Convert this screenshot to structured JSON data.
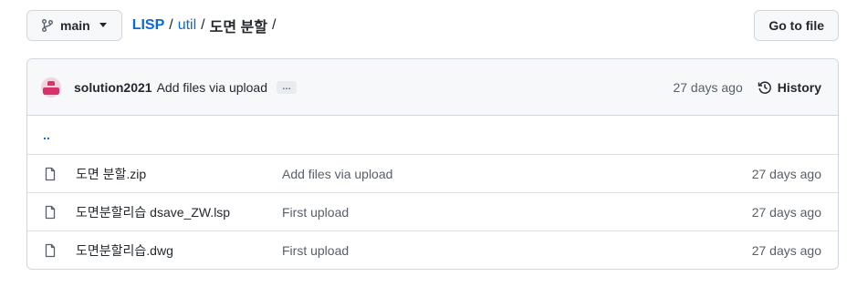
{
  "branch": {
    "label": "main"
  },
  "breadcrumb": {
    "repo": "LISP",
    "folder": "util",
    "current": "도면 분할",
    "separator": "/"
  },
  "toolbar": {
    "go_to_file": "Go to file"
  },
  "latest_commit": {
    "author": "solution2021",
    "message": "Add files via upload",
    "ellipsis": "…",
    "time": "27 days ago",
    "history_label": "History"
  },
  "parent_dir": "..",
  "files": [
    {
      "name": "도면 분할.zip",
      "message": "Add files via upload",
      "time": "27 days ago",
      "icon": "file-icon"
    },
    {
      "name": "도면분할리습 dsave_ZW.lsp",
      "message": "First upload",
      "time": "27 days ago",
      "icon": "file-icon"
    },
    {
      "name": "도면분할리습.dwg",
      "message": "First upload",
      "time": "27 days ago",
      "icon": "file-icon"
    }
  ],
  "colors": {
    "link": "#0969da",
    "border": "#d0d7de",
    "header_bg": "#f6f8fa",
    "muted": "#57606a"
  }
}
